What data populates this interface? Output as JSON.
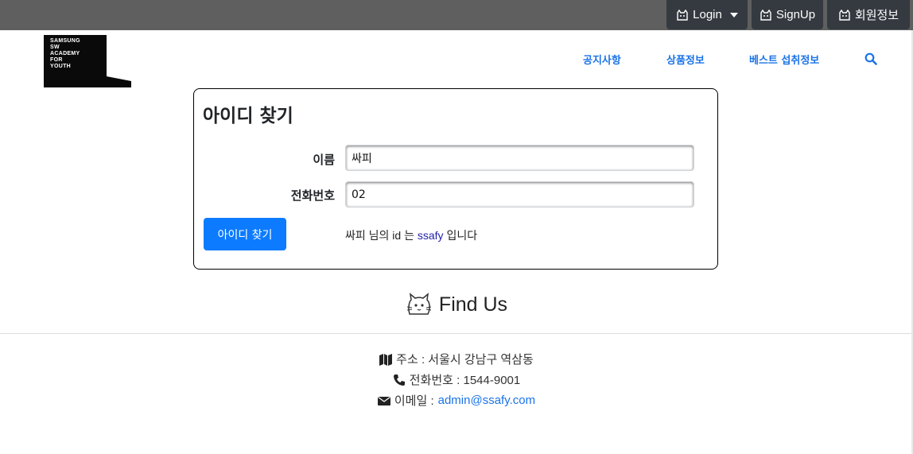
{
  "topbar": {
    "login_label": "Login",
    "signup_label": "SignUp",
    "member_label": "회원정보",
    "icons": [
      "cat-icon",
      "caret-down-icon"
    ]
  },
  "header": {
    "logo_lines": [
      "SAMSUNG",
      "SW",
      "ACADEMY",
      "FOR",
      "YOUTH"
    ],
    "nav": [
      "공지사항",
      "상품정보",
      "베스트 섭취정보"
    ],
    "search_icon": "search-icon"
  },
  "card": {
    "title": "아이디 찾기",
    "name_label": "이름",
    "name_value": "싸피",
    "phone_label": "전화번호",
    "phone_value": "02",
    "submit_label": "아이디 찾기",
    "result_prefix": "싸피 님의 id 는",
    "result_id": "ssafy",
    "result_suffix": "입니다"
  },
  "findus": {
    "title": "Find Us"
  },
  "footer": {
    "address": "주소 : 서울시 강남구 역삼동",
    "phone": "전화번호 : 1544-9001",
    "email_label": "이메일 :",
    "email": "admin@ssafy.com"
  },
  "colors": {
    "accent": "#0d7bff",
    "link": "#1a73e8",
    "topbar": "#5f5f5f",
    "topbutton": "#343a40"
  }
}
